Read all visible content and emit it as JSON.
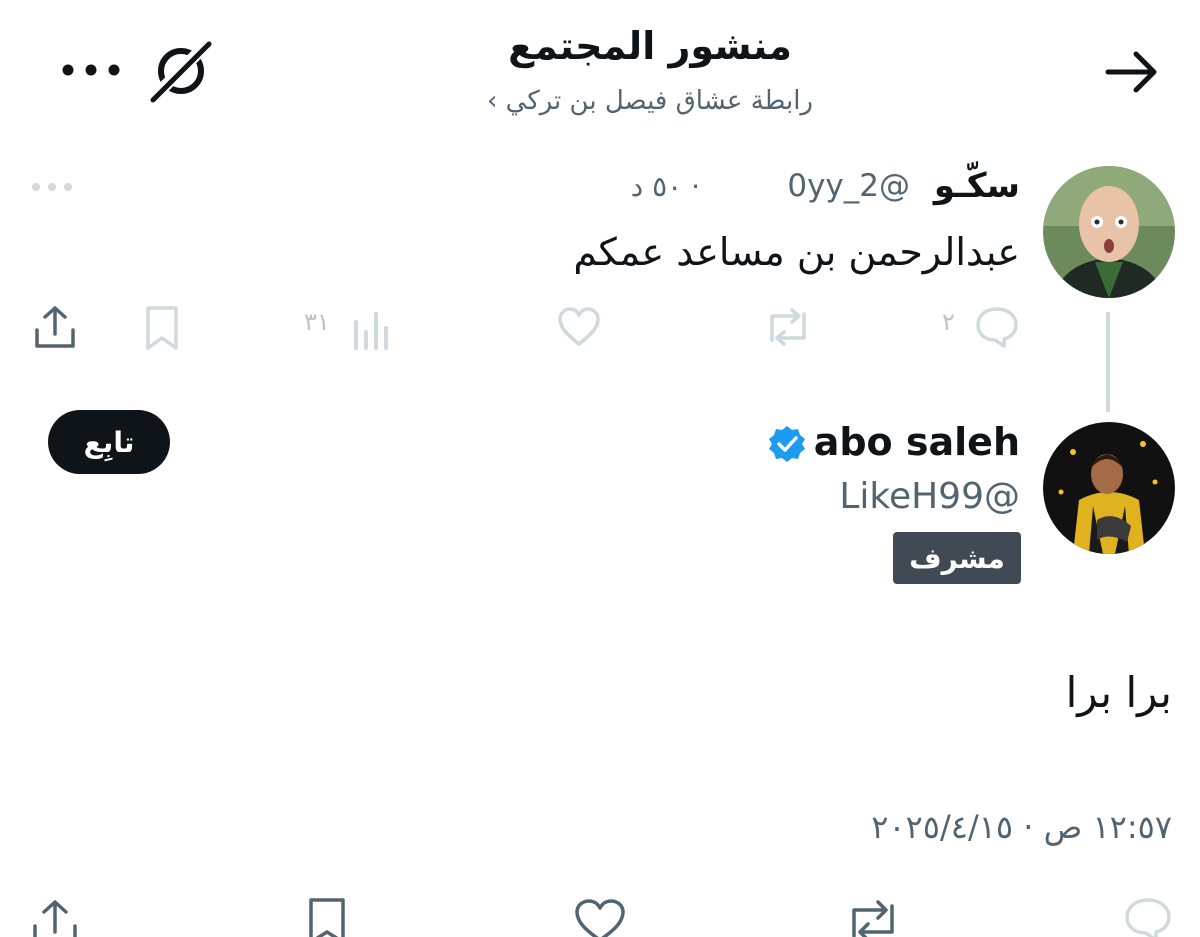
{
  "header": {
    "title": "منشور المجتمع",
    "subtitle": "رابطة عشاق فيصل بن تركي ›",
    "back_icon": "arrow-right-icon",
    "grok_icon": "grok-icon",
    "more_icon": "more-horizontal-icon"
  },
  "reply_post": {
    "display_name": "سكّـو",
    "handle": "@2_0yy",
    "time": "· ٥٠ د",
    "text": "عبدالرحمن بن مساعد عمكم",
    "actions": {
      "replies": "٢",
      "views": "٣١"
    }
  },
  "main_post": {
    "display_name": "abo saleh",
    "handle": "@LikeH99",
    "badge": "مشرف",
    "follow_label": "تابِع",
    "text": "برا برا",
    "timestamp": "١٢:٥٧ ص · ٢٠٢٥/٤/١٥"
  },
  "colors": {
    "text_primary": "#0f1419",
    "text_secondary": "#536471",
    "verified_blue": "#1d9bf0",
    "icon_muted": "#cfd9de"
  }
}
